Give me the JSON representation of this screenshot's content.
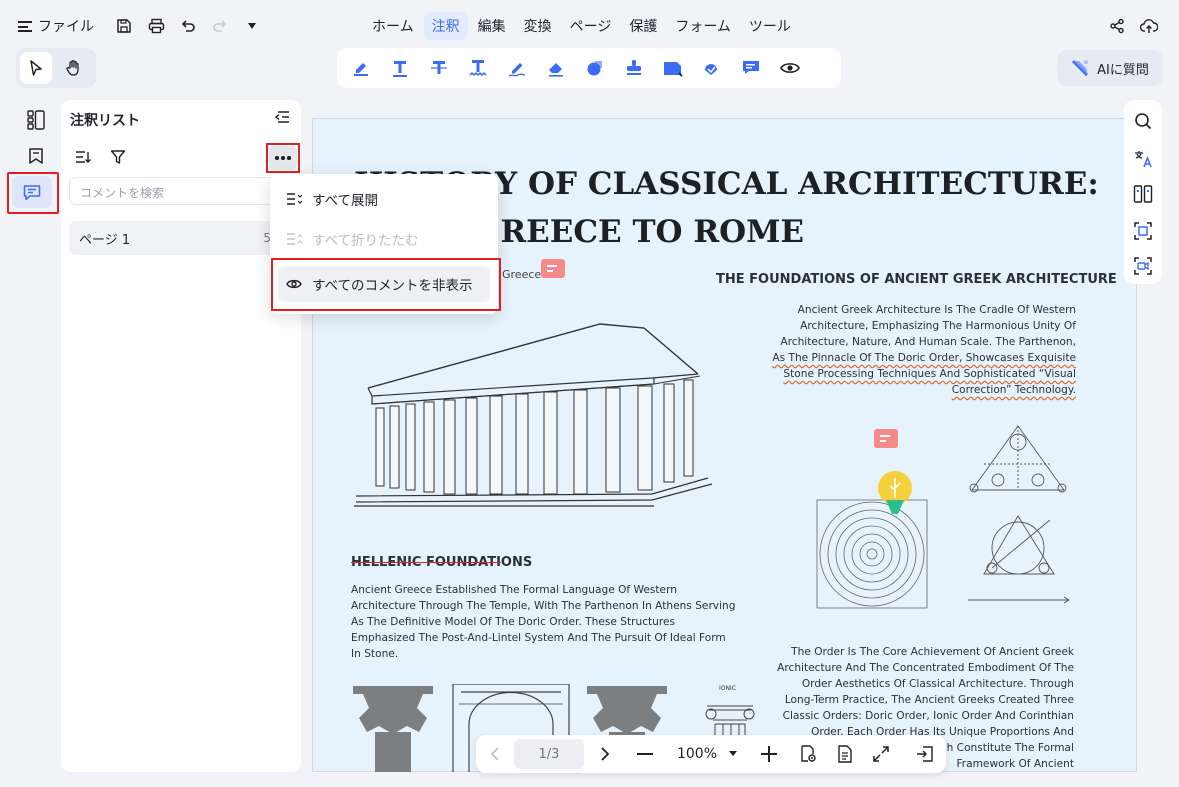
{
  "topbar": {
    "file_label": "ファイル",
    "nav_tabs": [
      "ホーム",
      "注釈",
      "編集",
      "変換",
      "ページ",
      "保護",
      "フォーム",
      "ツール"
    ],
    "active_tab": "注釈",
    "ai_label": "AIに質問"
  },
  "panel": {
    "title": "注釈リスト",
    "search_placeholder": "コメントを検索",
    "page_label": "ページ 1",
    "page_count": "5"
  },
  "dropdown": {
    "expand_all": "すべて展開",
    "collapse_all": "すべて折りたたむ",
    "hide_all": "すべてのコメントを非表示"
  },
  "document": {
    "title_line1": "HISTORY OF CLASSICAL  ARCHITECTURE:",
    "title_line2": "FROM GREECE TO ROME",
    "subtitle_fragment": "Greece",
    "greek_heading": "THE FOUNDATIONS OF ANCIENT GREEK ARCHITECTURE",
    "greek_para_plain": "Ancient Greek Architecture Is The Cradle Of Western Architecture, Emphasizing The Harmonious Unity Of Architecture, Nature, And Human Scale. The Parthenon, ",
    "greek_para_marked": "As The Pinnacle Of The Doric Order, Showcases Exquisite Stone Processing Techniques And Sophisticated “Visual Correction” Technology.",
    "hellenic_heading_strike": "HELLENIC FOUNDATI",
    "hellenic_heading_rest": "ONS",
    "hellenic_para": "Ancient Greece Established The Formal Language Of Western Architecture Through The Temple, With The Parthenon In Athens Serving As The Definitive Model Of The Doric Order. These Structures Emphasized The Post-And-Lintel System And The Pursuit Of Ideal Form In Stone.",
    "order_para": "The Order Is The Core Achievement Of Ancient Greek Architecture And The Concentrated Embodiment Of The Order Aesthetics Of Classical Architecture. Through Long-Term Practice, The Ancient Greeks Created Three Classic Orders: Doric Order, Ionic Order And Corinthian Order. Each Order Has Its Unique Proportions And Symbolic Meanings, Which Constitute The Formal Framework Of Ancient",
    "ionic_label": "IONIC"
  },
  "pagebar": {
    "page_indicator": "1/3",
    "zoom": "100%"
  },
  "colors": {
    "accent": "#3b6cf6",
    "highlight_border": "#e02020",
    "comment_note": "#f48a8a",
    "doc_bg": "#e6f2fc"
  }
}
